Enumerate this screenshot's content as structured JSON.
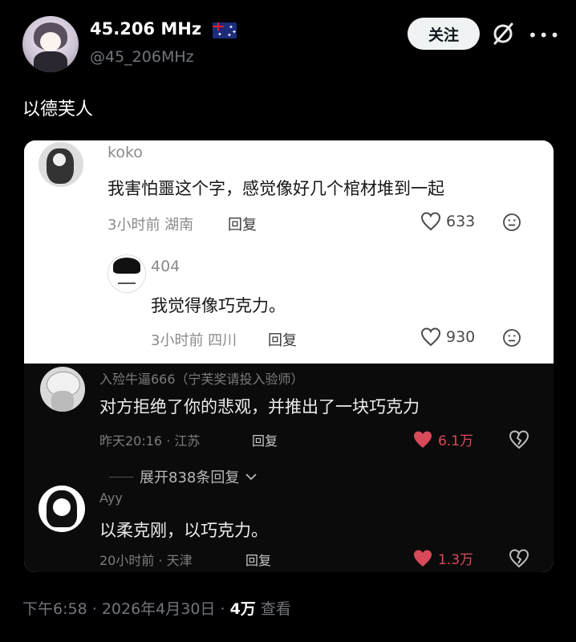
{
  "author": {
    "display_name": "45.206 MHz",
    "handle": "@45_206MHz",
    "follow_label": "关注"
  },
  "post": {
    "text": "以德芙人"
  },
  "embedded": {
    "comments": [
      {
        "username": "koko",
        "text": "我害怕噩这个字，感觉像好几个棺材堆到一起",
        "meta": "3小时前 湖南",
        "reply_label": "回复",
        "likes": "633"
      },
      {
        "username": "404",
        "text": "我觉得像巧克力。",
        "meta": "3小时前 四川",
        "reply_label": "回复",
        "likes": "930"
      },
      {
        "username": "入殓牛逼666（宁芙奖请投入验师）",
        "text": "对方拒绝了你的悲观，并推出了一块巧克力",
        "meta": "昨天20:16 · 江苏",
        "reply_label": "回复",
        "likes": "6.1万"
      },
      {
        "username": "Ayy",
        "text": "以柔克刚，以巧克力。",
        "meta": "20小时前 · 天津",
        "reply_label": "回复",
        "likes": "1.3万"
      }
    ],
    "expand_label": "展开838条回复"
  },
  "footer": {
    "time": "下午6:58",
    "date": "2026年4月30日",
    "views": "4万",
    "views_label": "查看"
  },
  "colors": {
    "background": "#000000",
    "like_red": "#d84a5a"
  }
}
